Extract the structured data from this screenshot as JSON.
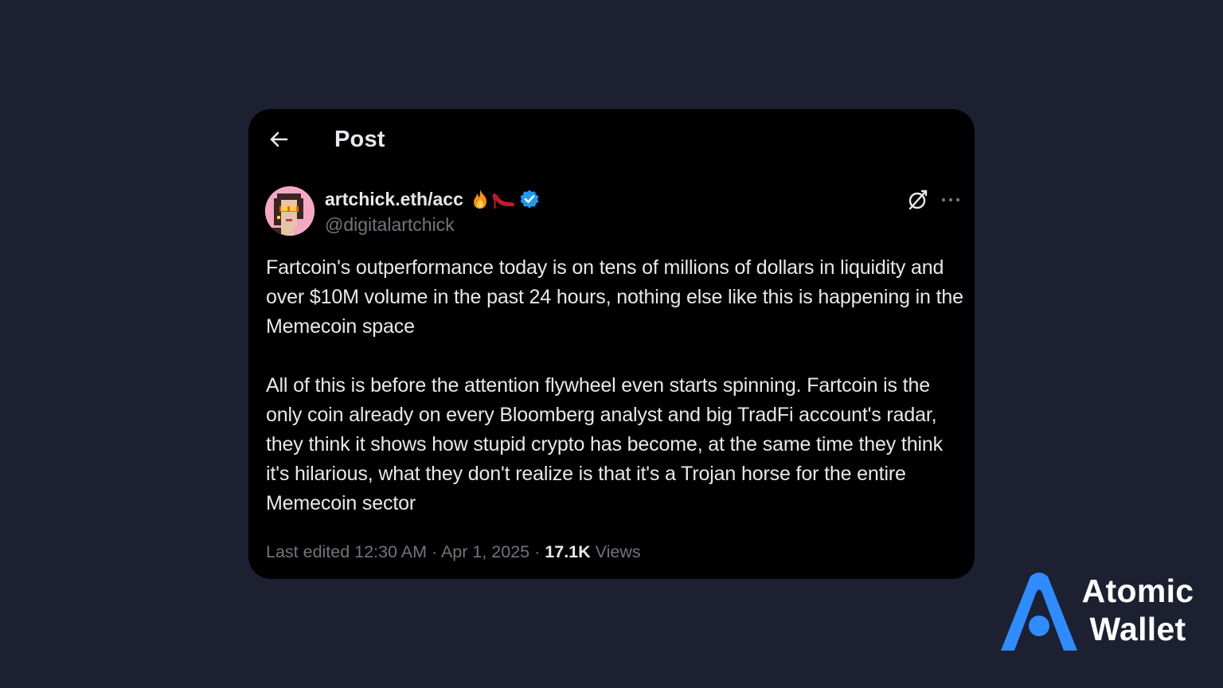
{
  "header": {
    "title": "Post",
    "back_icon": "arrow-left-icon"
  },
  "post": {
    "author": {
      "display_name": "artchick.eth/acc",
      "emoji": [
        "fire",
        "high-heel"
      ],
      "verified": true,
      "handle": "@digitalartchick"
    },
    "paragraphs": [
      "Fartcoin's outperformance today is on tens of millions of dollars in liquidity and over $10M volume in the past 24 hours, nothing else like this is happening in the Memecoin space",
      "All of this is before the attention flywheel even starts spinning.  Fartcoin is the only coin already on every Bloomberg analyst and big TradFi account's radar, they think it shows how stupid crypto has become, at the same time they think it's hilarious, what they don't realize is that it's a Trojan horse for the entire Memecoin sector"
    ],
    "meta": {
      "edited": "Last edited 12:30 AM",
      "separator": "·",
      "date": "Apr 1, 2025",
      "views_count": "17.1K",
      "views_label": "Views"
    }
  },
  "icons": {
    "grok": "grok-icon",
    "more": "more-icon"
  },
  "brand": {
    "line1": "Atomic",
    "line2": "Wallet",
    "color": "#2f8cff"
  },
  "colors": {
    "background": "#1c2031",
    "card": "#000000",
    "text_primary": "#e7e9ea",
    "text_secondary": "#71767b",
    "verified": "#1d9bf0"
  }
}
